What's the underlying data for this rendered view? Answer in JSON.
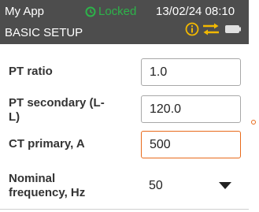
{
  "header": {
    "app_name": "My App",
    "lock_status": "Locked",
    "datetime": "13/02/24 08:10",
    "title": "BASIC SETUP",
    "icons": [
      "info-icon",
      "swap-arrows-icon",
      "battery-icon"
    ],
    "colors": {
      "background": "#4d4d4d",
      "locked": "#2db34a",
      "accent_icons": "#f2b800"
    }
  },
  "settings": [
    {
      "label": "PT ratio",
      "value": "1.0",
      "type": "input"
    },
    {
      "label": "PT secondary (L-L)",
      "value": "120.0",
      "type": "input"
    },
    {
      "label": "CT primary, A",
      "value": "500",
      "type": "input",
      "focused": true
    },
    {
      "label": "Nominal frequency, Hz",
      "value": "50",
      "type": "select"
    }
  ],
  "focus_color": "#e86a1b"
}
